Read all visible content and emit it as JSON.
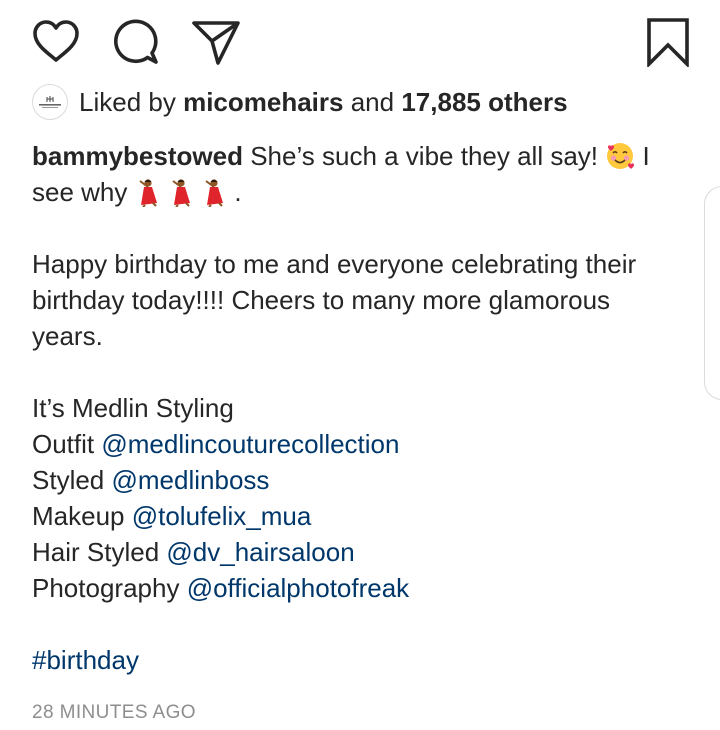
{
  "actions": {
    "like_icon": "heart-icon",
    "comment_icon": "comment-icon",
    "share_icon": "paper-plane-icon",
    "save_icon": "bookmark-icon"
  },
  "likes": {
    "prefix": "Liked by",
    "user": "micomehairs",
    "connector": "and",
    "count": "17,885 others"
  },
  "caption": {
    "username": "bammybestowed",
    "line1_text": "She’s such a vibe they all say!",
    "line1_tail": "I",
    "line2_text": "see why",
    "line2_tail": ".",
    "para2_line1": "Happy birthday to me and everyone celebrating their",
    "para2_line2": "birthday today!!!! Cheers to many more glamorous",
    "para2_line3": "years.",
    "credits_title": "It’s Medlin Styling",
    "credits": [
      {
        "label": "Outfit",
        "handle": "@medlincouturecollection"
      },
      {
        "label": "Styled",
        "handle": "@medlinboss"
      },
      {
        "label": "Makeup",
        "handle": "@tolufelix_mua"
      },
      {
        "label": "Hair Styled",
        "handle": "@dv_hairsaloon"
      },
      {
        "label": "Photography",
        "handle": "@officialphotofreak"
      }
    ],
    "hashtag": "#birthday"
  },
  "timestamp": "28 MINUTES AGO",
  "emojis": {
    "hearts_face": "smiling-face-with-hearts-emoji",
    "dancer": "woman-dancing-emoji"
  }
}
